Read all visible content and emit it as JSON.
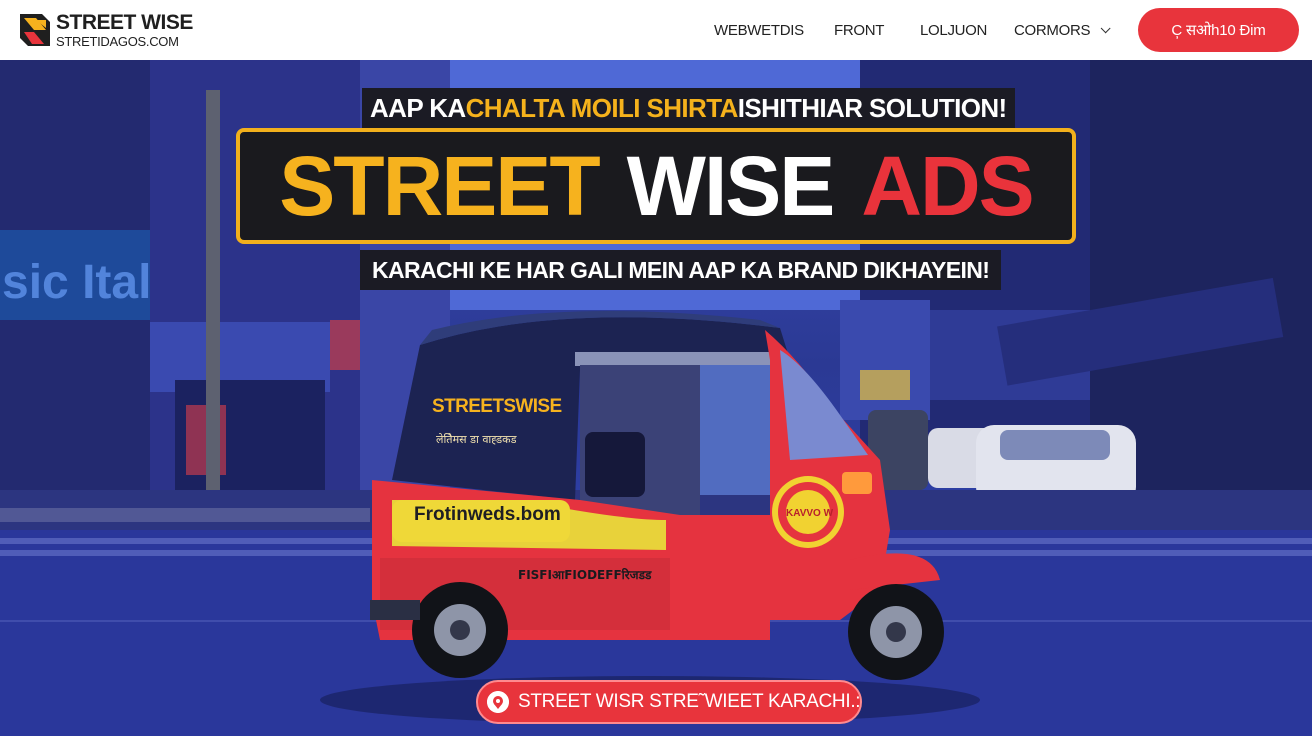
{
  "header": {
    "logo_title": "STREET WISE",
    "logo_subtitle": "STRETIDAGOS.COM",
    "nav": [
      {
        "label": "WEBWETDIS"
      },
      {
        "label": "FRONT"
      },
      {
        "label": "LOLJUON"
      },
      {
        "label": "CORMORS",
        "has_dropdown": true
      }
    ],
    "cta_label": "C̦ सओh10 Đim"
  },
  "hero": {
    "tagline_top": {
      "white_1": "AAP KA ",
      "yellow": "CHALTA MOILI SHIRTA",
      "white_2": " ISHITHIAR SOLUTION!"
    },
    "headline": {
      "word_1": "STREET",
      "word_2": "WISE",
      "word_3": "ADS"
    },
    "tagline_bottom": "KARACHI KE HAR GALI MEIN AAP KA BRAND DIKHAYEIN!",
    "rickshaw": {
      "canopy_logo": "STREETSWISE",
      "canopy_subtext": "लेतेिमस डा वाह्डकड",
      "side_banner": "Frotinweds.bom",
      "lower_text": "FISFIआFIODEFFरिजडड",
      "door_badge": "KAVVO W"
    },
    "bottom_pill_label": "STREET WISR STRE˜WIEET KARACHI.:"
  },
  "colors": {
    "brand_red": "#e8343c",
    "brand_yellow": "#f6b21e",
    "headline_bg": "#1a1a1e"
  },
  "icons": {
    "logo": "streetwise-logo-mark",
    "dropdown": "chevron-down-icon",
    "pill": "pin-icon"
  }
}
